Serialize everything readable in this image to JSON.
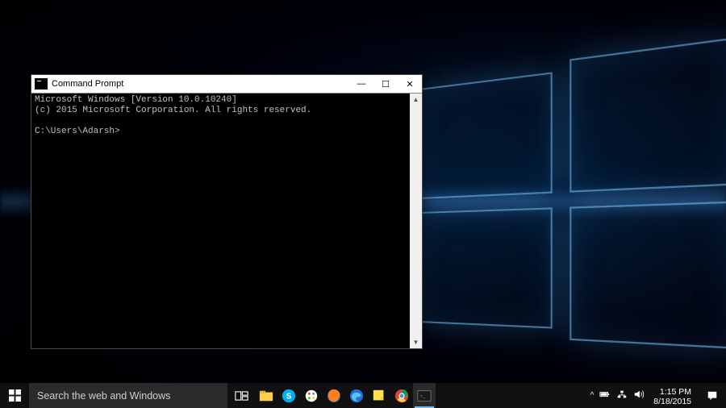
{
  "window": {
    "title": "Command Prompt",
    "min": "—",
    "max": "☐",
    "close": "✕",
    "scroll_up": "▲",
    "scroll_down": "▼"
  },
  "terminal": {
    "line1": "Microsoft Windows [Version 10.0.10240]",
    "line2": "(c) 2015 Microsoft Corporation. All rights reserved.",
    "blank": "",
    "prompt": "C:\\Users\\Adarsh>"
  },
  "taskbar": {
    "search_placeholder": "Search the web and Windows",
    "tray_chevron": "^",
    "time": "1:15 PM",
    "date": "8/18/2015"
  }
}
